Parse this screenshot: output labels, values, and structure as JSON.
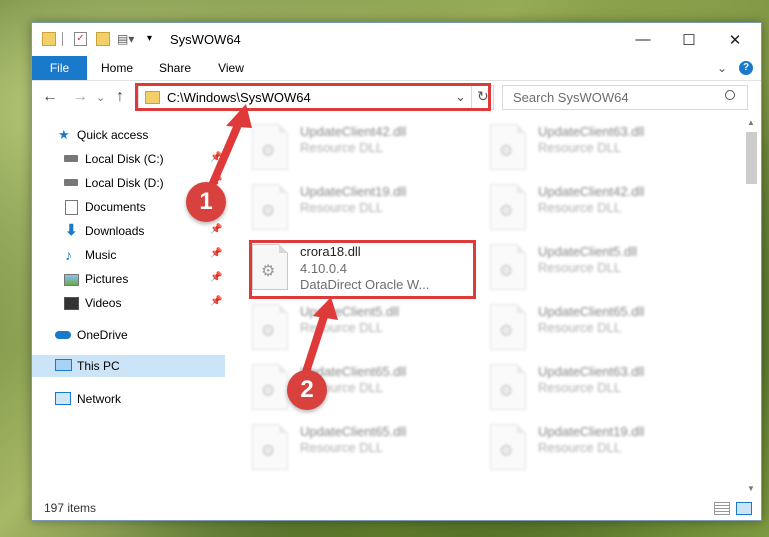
{
  "window": {
    "title": "SysWOW64",
    "minimize": "—",
    "maximize": "☐",
    "close": "✕"
  },
  "ribbon": {
    "tabs": [
      "File",
      "Home",
      "Share",
      "View"
    ],
    "expand": "⌄",
    "help": "?"
  },
  "nav": {
    "back": "←",
    "forward": "→",
    "dropdown": "⌄",
    "up": "↑",
    "address": "C:\\Windows\\SysWOW64",
    "search_placeholder": "Search SysWOW64",
    "address_chevron": "⌄",
    "refresh": "↻"
  },
  "sidebar": {
    "items": [
      {
        "label": "Quick access",
        "icon": "star-icon",
        "pinned": false
      },
      {
        "label": "Local Disk (C:)",
        "icon": "drive-icon",
        "pinned": true
      },
      {
        "label": "Local Disk (D:)",
        "icon": "drive-icon",
        "pinned": true
      },
      {
        "label": "Documents",
        "icon": "document-icon",
        "pinned": true
      },
      {
        "label": "Downloads",
        "icon": "download-icon",
        "pinned": true
      },
      {
        "label": "Music",
        "icon": "music-icon",
        "pinned": true
      },
      {
        "label": "Pictures",
        "icon": "pictures-icon",
        "pinned": true
      },
      {
        "label": "Videos",
        "icon": "videos-icon",
        "pinned": true
      },
      {
        "label": "OneDrive",
        "icon": "onedrive-icon",
        "pinned": false
      },
      {
        "label": "This PC",
        "icon": "computer-icon",
        "pinned": false,
        "selected": true
      },
      {
        "label": "Network",
        "icon": "network-icon",
        "pinned": false
      }
    ]
  },
  "files": {
    "left": [
      {
        "name": "UpdateClient42.dll",
        "type": "Resource DLL"
      },
      {
        "name": "UpdateClient19.dll",
        "type": "Resource DLL"
      },
      {
        "name": "crora18.dll",
        "version": "4.10.0.4",
        "desc": "DataDirect Oracle W...",
        "highlighted": true
      },
      {
        "name": "UpdateClient5.dll",
        "type": "Resource DLL"
      },
      {
        "name": "UpdateClient65.dll",
        "type": "Resource DLL"
      },
      {
        "name": "UpdateClient65.dll",
        "type": "Resource DLL"
      }
    ],
    "right": [
      {
        "name": "UpdateClient63.dll",
        "type": "Resource DLL"
      },
      {
        "name": "UpdateClient42.dll",
        "type": "Resource DLL"
      },
      {
        "name": "UpdateClient5.dll",
        "type": "Resource DLL"
      },
      {
        "name": "UpdateClient65.dll",
        "type": "Resource DLL"
      },
      {
        "name": "UpdateClient63.dll",
        "type": "Resource DLL"
      },
      {
        "name": "UpdateClient19.dll",
        "type": "Resource DLL"
      }
    ]
  },
  "status": {
    "count": "197 items"
  },
  "annotations": {
    "marker1": "1",
    "marker2": "2"
  },
  "colors": {
    "accent": "#1979ca",
    "annotation": "#de3a3a"
  }
}
